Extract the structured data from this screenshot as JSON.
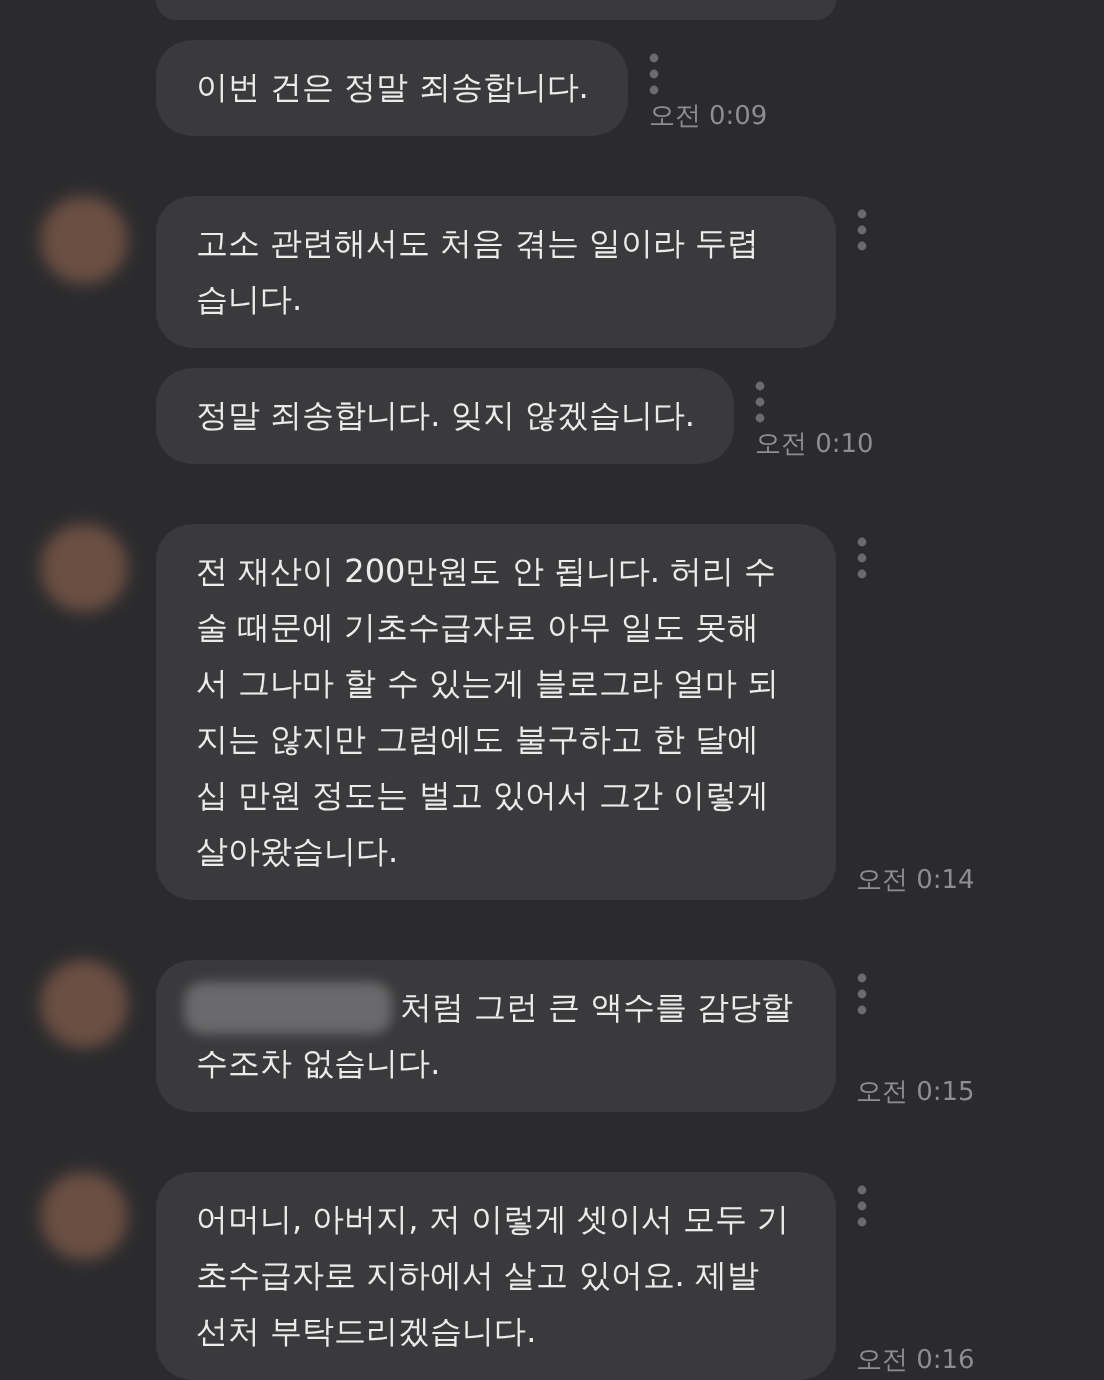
{
  "partial_top_bubble": true,
  "groups": [
    {
      "avatar": false,
      "messages": [
        {
          "lines": [
            "이번 건은 정말 죄송합니다."
          ],
          "time": "오전 0:09"
        }
      ]
    },
    {
      "avatar": true,
      "messages": [
        {
          "lines": [
            "고소 관련해서도 처음 겪는 일이라 두렵",
            "습니다."
          ]
        },
        {
          "lines": [
            "정말 죄송합니다. 잊지 않겠습니다."
          ],
          "time": "오전 0:10"
        }
      ]
    },
    {
      "avatar": true,
      "messages": [
        {
          "lines": [
            "전 재산이 200만원도 안 됩니다. 허리 수",
            "술 때문에 기초수급자로 아무 일도 못해",
            "서 그나마 할 수 있는게 블로그라 얼마 되",
            "지는 않지만 그럼에도 불구하고 한 달에",
            "십 만원 정도는 벌고 있어서 그간 이렇게",
            "살아왔습니다."
          ],
          "time": "오전 0:14"
        }
      ]
    },
    {
      "avatar": true,
      "messages": [
        {
          "redacted_prefix": true,
          "lines": [
            "처럼 그런 큰 액수를 감당할",
            "수조차 없습니다."
          ],
          "time": "오전 0:15"
        }
      ]
    },
    {
      "avatar": true,
      "messages": [
        {
          "lines": [
            "어머니, 아버지, 저 이렇게 셋이서 모두 기",
            "초수급자로 지하에서 살고 있어요. 제발",
            "선처 부탁드리겠습니다."
          ],
          "time": "오전 0:16"
        }
      ]
    }
  ]
}
